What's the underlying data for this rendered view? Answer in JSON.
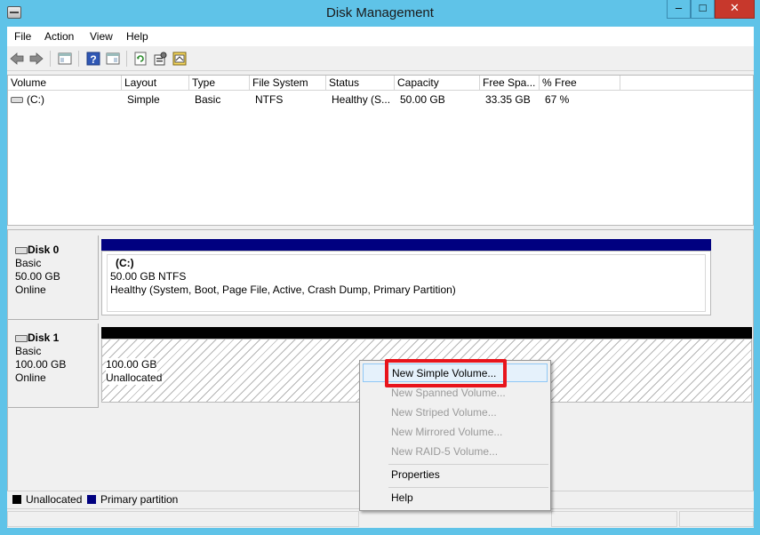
{
  "window": {
    "title": "Disk Management",
    "controls": {
      "minimize": "–",
      "maximize": "□",
      "close": "✕"
    }
  },
  "menubar": {
    "items": [
      "File",
      "Action",
      "View",
      "Help"
    ]
  },
  "toolbar": {
    "buttons": [
      "back-arrow-icon",
      "forward-arrow-icon",
      "show-hide-console-tree-icon",
      "help-icon",
      "console-window-icon",
      "refresh-icon",
      "properties-icon",
      "wizard-icon"
    ]
  },
  "volume_list": {
    "columns": [
      "Volume",
      "Layout",
      "Type",
      "File System",
      "Status",
      "Capacity",
      "Free Spa...",
      "% Free"
    ],
    "rows": [
      {
        "volume": "(C:)",
        "layout": "Simple",
        "type": "Basic",
        "file_system": "NTFS",
        "status": "Healthy (S...",
        "capacity": "50.00 GB",
        "free_space": "33.35 GB",
        "percent_free": "67 %"
      }
    ]
  },
  "disks": [
    {
      "name": "Disk 0",
      "type": "Basic",
      "size": "50.00 GB",
      "state": "Online",
      "partition": {
        "label": "(C:)",
        "size_fs": "50.00 GB NTFS",
        "status": "Healthy (System, Boot, Page File, Active, Crash Dump, Primary Partition)"
      }
    },
    {
      "name": "Disk 1",
      "type": "Basic",
      "size": "100.00 GB",
      "state": "Online",
      "unallocated": {
        "size": "100.00 GB",
        "label": "Unallocated"
      }
    }
  ],
  "legend": [
    {
      "label": "Unallocated",
      "color": "#000000"
    },
    {
      "label": "Primary partition",
      "color": "#000080"
    }
  ],
  "context_menu": {
    "items": [
      {
        "label": "New Simple Volume...",
        "enabled": true,
        "highlighted": true
      },
      {
        "label": "New Spanned Volume...",
        "enabled": false
      },
      {
        "label": "New Striped Volume...",
        "enabled": false
      },
      {
        "label": "New Mirrored Volume...",
        "enabled": false
      },
      {
        "label": "New RAID-5 Volume...",
        "enabled": false
      },
      {
        "label": "Properties",
        "enabled": true
      },
      {
        "label": "Help",
        "enabled": true
      }
    ]
  },
  "colors": {
    "title_bar": "#5fc3e8",
    "close_button": "#c7382c",
    "primary_partition": "#000080",
    "unallocated": "#000000",
    "annotation_box": "#e8141c"
  }
}
